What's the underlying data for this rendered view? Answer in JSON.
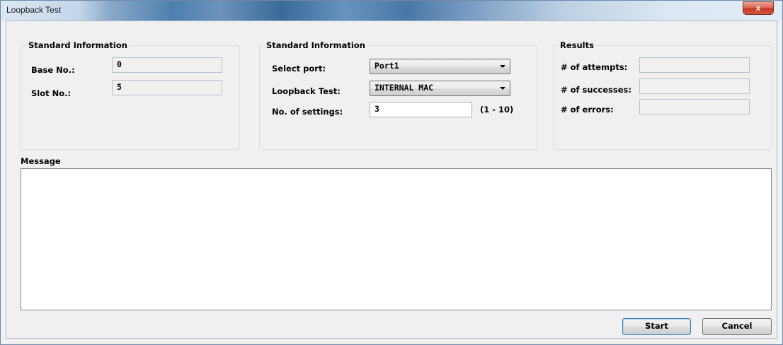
{
  "window": {
    "title": "Loopback Test",
    "close_symbol": "x"
  },
  "group_left": {
    "title": "Standard Information",
    "base_label": "Base No.:",
    "base_value": "0",
    "slot_label": "Slot No.:",
    "slot_value": "5"
  },
  "group_middle": {
    "title": "Standard Information",
    "port_label": "Select port:",
    "port_value": "Port1",
    "test_label": "Loopback Test:",
    "test_value": "INTERNAL MAC",
    "settings_label": "No. of settings:",
    "settings_value": "3",
    "settings_range": "(1 - 10)"
  },
  "group_results": {
    "title": "Results",
    "attempts_label": "# of attempts:",
    "attempts_value": "",
    "successes_label": "# of successes:",
    "successes_value": "",
    "errors_label": "# of errors:",
    "errors_value": ""
  },
  "message": {
    "label": "Message",
    "text": ""
  },
  "buttons": {
    "start": "Start",
    "cancel": "Cancel"
  },
  "colors": {
    "close_button": "#c3391f",
    "titlebar_accent": "#4d7fae"
  }
}
